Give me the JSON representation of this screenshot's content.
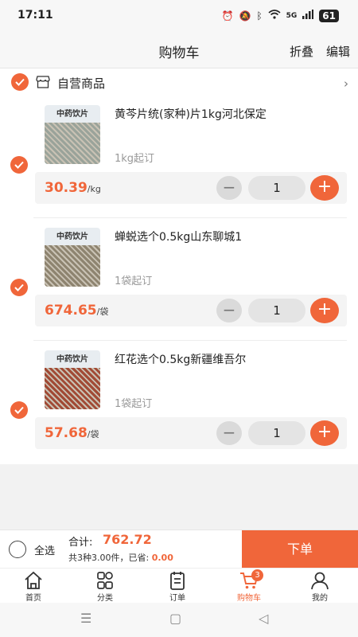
{
  "status": {
    "time": "17:11",
    "network": "5G",
    "battery": "61",
    "icons": [
      "alarm-icon",
      "mute-icon",
      "bluetooth-icon",
      "wifi-icon",
      "signal-icon",
      "battery-icon"
    ]
  },
  "header": {
    "title": "购物车",
    "fold_label": "折叠",
    "edit_label": "编辑"
  },
  "store": {
    "name": "自营商品"
  },
  "items": [
    {
      "name": "黄芩片统(家种)片1kg河北保定",
      "moq": "1kg起订",
      "price": "30.39",
      "unit": "/kg",
      "qty": "1",
      "thumb_label": "中药饮片",
      "thumb_color": "#9aa39a"
    },
    {
      "name": "蝉蜕选个0.5kg山东聊城1",
      "moq": "1袋起订",
      "price": "674.65",
      "unit": "/袋",
      "qty": "1",
      "thumb_label": "中药饮片",
      "thumb_color": "#8e8470"
    },
    {
      "name": "红花选个0.5kg新疆维吾尔",
      "moq": "1袋起订",
      "price": "57.68",
      "unit": "/袋",
      "qty": "1",
      "thumb_label": "中药饮片",
      "thumb_color": "#a14a35"
    }
  ],
  "controls": {
    "minus": "−",
    "plus": "+"
  },
  "checkout": {
    "select_all_label": "全选",
    "total_label": "合计:",
    "total_value": "762.72",
    "summary_prefix": "共3种3.00件，已省:",
    "saved_value": "0.00",
    "order_button": "下单"
  },
  "tabs": [
    {
      "label": "首页",
      "icon": "home-icon"
    },
    {
      "label": "分类",
      "icon": "category-icon"
    },
    {
      "label": "订单",
      "icon": "order-icon"
    },
    {
      "label": "购物车",
      "icon": "cart-icon",
      "badge": "3",
      "active": true
    },
    {
      "label": "我的",
      "icon": "profile-icon"
    }
  ],
  "colors": {
    "accent": "#f0663a",
    "background": "#f2f2f2"
  }
}
